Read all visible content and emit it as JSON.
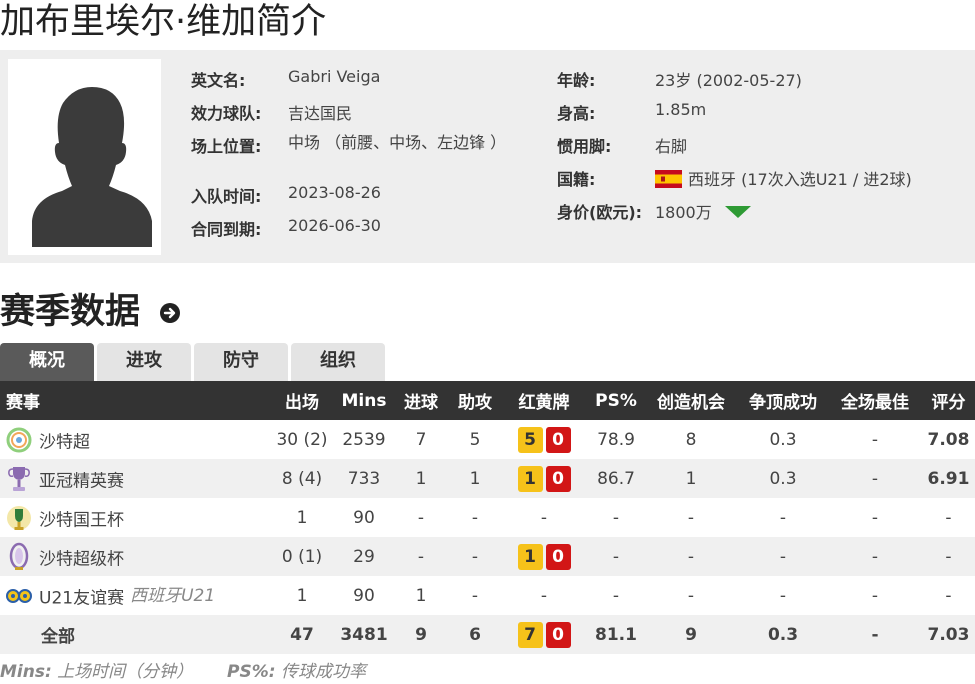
{
  "page": {
    "title": "加布里埃尔·维加简介"
  },
  "profile": {
    "english_name_label": "英文名:",
    "english_name": "Gabri Veiga",
    "club_label": "效力球队:",
    "club": "吉达国民",
    "position_label": "场上位置:",
    "position": "中场 （前腰、中场、左边锋 ）",
    "joined_label": "入队时间:",
    "joined": "2023-08-26",
    "contract_label": "合同到期:",
    "contract": "2026-06-30",
    "age_label": "年龄:",
    "age": "23岁 (2002-05-27)",
    "height_label": "身高:",
    "height": "1.85m",
    "foot_label": "惯用脚:",
    "foot": "右脚",
    "nationality_label": "国籍:",
    "nationality": "西班牙 (17次入选U21 / 进2球)",
    "value_label": "身价(欧元):",
    "value": "1800万",
    "value_trend_color": "#2e9a34"
  },
  "season": {
    "title": "赛季数据",
    "tabs": [
      "概况",
      "进攻",
      "防守",
      "组织"
    ],
    "active_tab": 0,
    "headers": [
      "赛事",
      "出场",
      "Mins",
      "进球",
      "助攻",
      "红黄牌",
      "PS%",
      "创造机会",
      "争顶成功",
      "全场最佳",
      "评分"
    ],
    "rows": [
      {
        "competition": "沙特超",
        "icon": "saudi-pro-league-icon",
        "note": "",
        "apps": "30 (2)",
        "mins": "2539",
        "goals": "7",
        "assists": "5",
        "yellow": "5",
        "red": "0",
        "ps": "78.9",
        "chances": "8",
        "aerials": "0.3",
        "motm": "-",
        "rating": "7.08"
      },
      {
        "competition": "亚冠精英赛",
        "icon": "afc-champions-league-icon",
        "note": "",
        "apps": "8 (4)",
        "mins": "733",
        "goals": "1",
        "assists": "1",
        "yellow": "1",
        "red": "0",
        "ps": "86.7",
        "chances": "1",
        "aerials": "0.3",
        "motm": "-",
        "rating": "6.91"
      },
      {
        "competition": "沙特国王杯",
        "icon": "kings-cup-icon",
        "note": "",
        "apps": "1",
        "mins": "90",
        "goals": "-",
        "assists": "-",
        "yellow": "",
        "red": "",
        "cards_text": "-",
        "ps": "-",
        "chances": "-",
        "aerials": "-",
        "motm": "-",
        "rating": "-"
      },
      {
        "competition": "沙特超级杯",
        "icon": "super-cup-icon",
        "note": "",
        "apps": "0 (1)",
        "mins": "29",
        "goals": "-",
        "assists": "-",
        "yellow": "1",
        "red": "0",
        "ps": "-",
        "chances": "-",
        "aerials": "-",
        "motm": "-",
        "rating": "-"
      },
      {
        "competition": "U21友谊赛",
        "icon": "friendly-icon",
        "note": "西班牙U21",
        "apps": "1",
        "mins": "90",
        "goals": "1",
        "assists": "-",
        "yellow": "",
        "red": "",
        "cards_text": "-",
        "ps": "-",
        "chances": "-",
        "aerials": "-",
        "motm": "-",
        "rating": "-"
      }
    ],
    "total": {
      "label": "全部",
      "apps": "47",
      "mins": "3481",
      "goals": "9",
      "assists": "6",
      "yellow": "7",
      "red": "0",
      "ps": "81.1",
      "chances": "9",
      "aerials": "0.3",
      "motm": "-",
      "rating": "7.03"
    }
  },
  "legend": {
    "mins_key": "Mins:",
    "mins_desc": "上场时间（分钟）",
    "ps_key": "PS%:",
    "ps_desc": "传球成功率"
  },
  "colors": {
    "header_bg": "#333333",
    "rating": "#e9690c",
    "yellow_card": "#f6c21a",
    "red_card": "#d21616"
  }
}
